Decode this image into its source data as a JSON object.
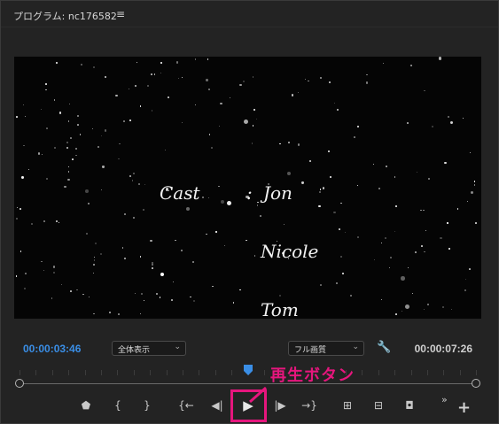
{
  "panel": {
    "title": "プログラム: nc176582",
    "menu_icon": "hamburger-menu-icon"
  },
  "viewer": {
    "credits": {
      "label": "Cast",
      "colon": ":",
      "names": [
        "Jon",
        "Nicole",
        "Tom"
      ]
    }
  },
  "controls": {
    "current_timecode": "00:00:03:46",
    "duration_timecode": "00:00:07:26",
    "zoom_select": {
      "value": "全体表示"
    },
    "quality_select": {
      "value": "フル画質"
    },
    "settings_icon": "wrench-icon"
  },
  "transport": {
    "buttons": [
      {
        "name": "add-marker-button",
        "icon": "marker-icon",
        "glyph": "⬟"
      },
      {
        "name": "mark-in-button",
        "icon": "mark-in-icon",
        "glyph": "{"
      },
      {
        "name": "mark-out-button",
        "icon": "mark-out-icon",
        "glyph": "}"
      },
      {
        "name": "go-to-in-button",
        "icon": "go-to-in-icon",
        "glyph": "{←"
      },
      {
        "name": "step-back-button",
        "icon": "step-back-icon",
        "glyph": "◀|"
      },
      {
        "name": "play-button",
        "icon": "play-icon",
        "glyph": "▶"
      },
      {
        "name": "step-forward-button",
        "icon": "step-forward-icon",
        "glyph": "|▶"
      },
      {
        "name": "go-to-out-button",
        "icon": "go-to-out-icon",
        "glyph": "→}"
      },
      {
        "name": "lift-button",
        "icon": "lift-icon",
        "glyph": "⊞"
      },
      {
        "name": "extract-button",
        "icon": "extract-icon",
        "glyph": "⊟"
      },
      {
        "name": "export-frame-button",
        "icon": "camera-icon",
        "glyph": "◘"
      }
    ],
    "more_icon": "»",
    "add_icon": "+"
  },
  "annotation": {
    "callout": "再生ボタン",
    "color": "#e6167d"
  },
  "colors": {
    "timecode_current": "#3a8ee6",
    "playhead": "#3a8ee6",
    "background": "#232323"
  }
}
